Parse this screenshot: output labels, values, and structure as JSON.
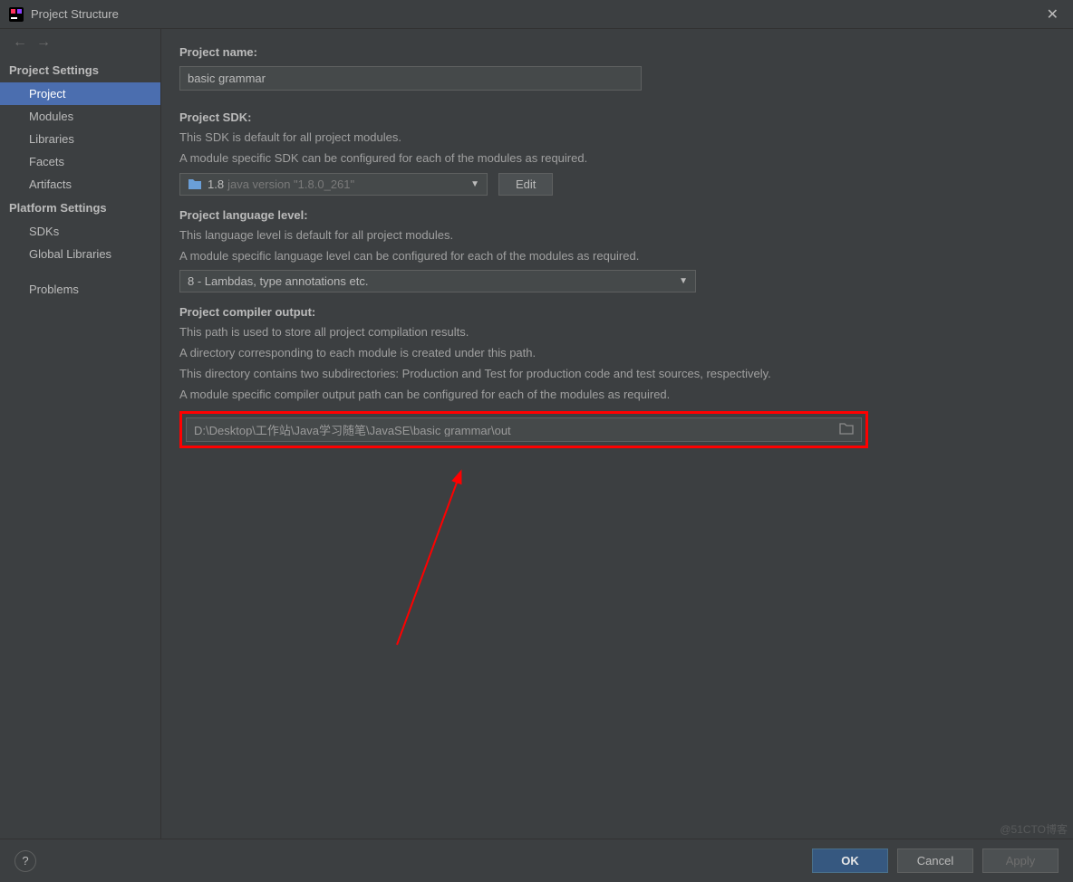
{
  "title": "Project Structure",
  "sidebar": {
    "projectSettings": {
      "header": "Project Settings",
      "items": [
        "Project",
        "Modules",
        "Libraries",
        "Facets",
        "Artifacts"
      ]
    },
    "platformSettings": {
      "header": "Platform Settings",
      "items": [
        "SDKs",
        "Global Libraries"
      ]
    },
    "problems": "Problems"
  },
  "projectName": {
    "label": "Project name:",
    "value": "basic grammar"
  },
  "projectSdk": {
    "label": "Project SDK:",
    "help1": "This SDK is default for all project modules.",
    "help2": "A module specific SDK can be configured for each of the modules as required.",
    "value": "1.8",
    "detail": "java version \"1.8.0_261\"",
    "editButton": "Edit"
  },
  "languageLevel": {
    "label": "Project language level:",
    "help1": "This language level is default for all project modules.",
    "help2": "A module specific language level can be configured for each of the modules as required.",
    "value": "8 - Lambdas, type annotations etc."
  },
  "compilerOutput": {
    "label": "Project compiler output:",
    "help1": "This path is used to store all project compilation results.",
    "help2": "A directory corresponding to each module is created under this path.",
    "help3": "This directory contains two subdirectories: Production and Test for production code and test sources, respectively.",
    "help4": "A module specific compiler output path can be configured for each of the modules as required.",
    "value": "D:\\Desktop\\工作站\\Java学习随笔\\JavaSE\\basic grammar\\out"
  },
  "footer": {
    "ok": "OK",
    "cancel": "Cancel",
    "apply": "Apply"
  },
  "watermark": "@51CTO博客"
}
